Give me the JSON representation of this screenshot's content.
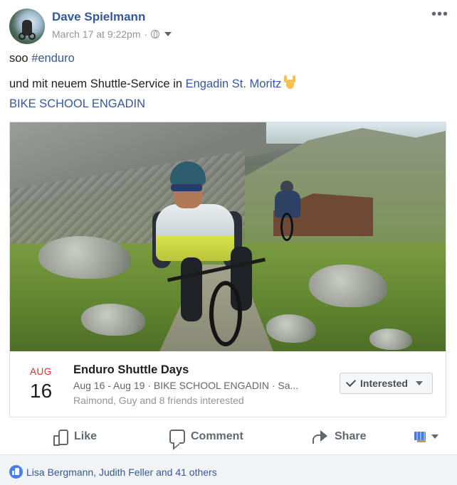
{
  "post": {
    "author": "Dave Spielmann",
    "timestamp": "March 17 at 9:22pm",
    "separator": "·",
    "privacy_icon": "globe-icon",
    "text": {
      "line1_prefix": "soo ",
      "line1_hashtag": "#enduro",
      "line2_prefix": "und mit neuem Shuttle-Service in ",
      "line2_link": "Engadin St. Moritz",
      "line2_emoji": "sign-of-the-horns-emoji",
      "line3_link": "BIKE SCHOOL ENGADIN"
    }
  },
  "event": {
    "month": "AUG",
    "day": "16",
    "title": "Enduro Shuttle Days",
    "details": "Aug 16 - Aug 19 · BIKE SCHOOL ENGADIN · Sa...",
    "friends": "Raimond, Guy and 8 friends interested",
    "interested_label": "Interested"
  },
  "actions": {
    "like": "Like",
    "comment": "Comment",
    "share": "Share"
  },
  "reactions": {
    "text": "Lisa Bergmann, Judith Feller and 41 others"
  },
  "colors": {
    "link": "#365899",
    "month_red": "#e02a2a",
    "reaction_blue": "#4a7ee8",
    "muted": "#90949c"
  }
}
